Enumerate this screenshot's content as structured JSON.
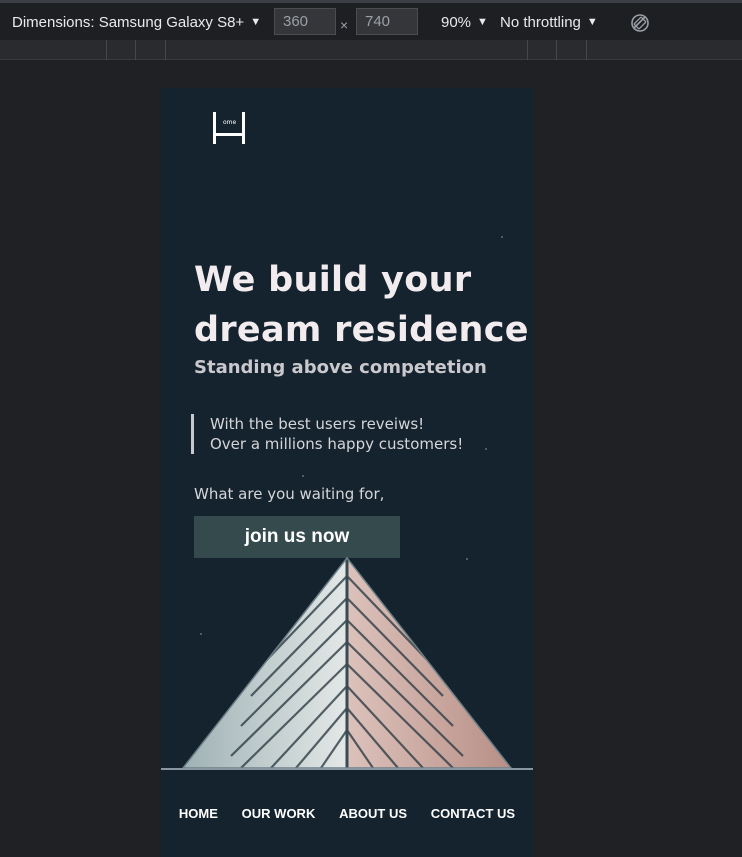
{
  "devtools": {
    "device_label": "Dimensions: Samsung Galaxy S8+",
    "width": "360",
    "times": "×",
    "height": "740",
    "zoom": "90%",
    "throttling": "No throttling",
    "caret": "▼"
  },
  "page": {
    "logo_text": "ome",
    "hero": {
      "title_line1": "We build your",
      "title_line2": "dream residence",
      "subtitle": "Standing above competetion"
    },
    "quote": {
      "line1": "With the best users reveiws!",
      "line2": "Over a millions happy customers!"
    },
    "cta": {
      "text": "What are you waiting for,",
      "button": "join us now"
    },
    "nav": [
      "HOME",
      "OUR WORK",
      "ABOUT US",
      "CONTACT US"
    ]
  }
}
